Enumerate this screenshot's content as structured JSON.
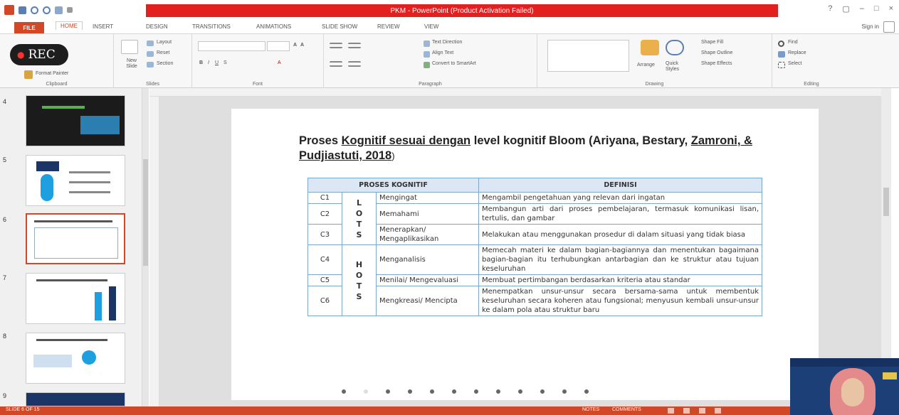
{
  "window": {
    "title": "PKM - PowerPoint (Product Activation Failed)",
    "controls": [
      "?",
      "▢",
      "–",
      "□",
      "×"
    ],
    "sign_in": "Sign in"
  },
  "tabs": [
    "FILE",
    "HOME",
    "INSERT",
    "DESIGN",
    "TRANSITIONS",
    "ANIMATIONS",
    "SLIDE SHOW",
    "REVIEW",
    "VIEW"
  ],
  "ribbon": {
    "clipboard": {
      "format_painter": "Format Painter",
      "label": "Clipboard"
    },
    "slides": {
      "new_slide": "New Slide",
      "layout": "Layout",
      "reset": "Reset",
      "section": "Section",
      "label": "Slides"
    },
    "font": {
      "label": "Font"
    },
    "paragraph": {
      "text_direction": "Text Direction",
      "align_text": "Align Text",
      "convert_smartart": "Convert to SmartArt",
      "label": "Paragraph"
    },
    "drawing": {
      "arrange": "Arrange",
      "quick_styles": "Quick Styles",
      "shape_fill": "Shape Fill",
      "shape_outline": "Shape Outline",
      "shape_effects": "Shape Effects",
      "label": "Drawing"
    },
    "editing": {
      "find": "Find",
      "replace": "Replace",
      "select": "Select",
      "label": "Editing"
    }
  },
  "recording": {
    "label": "REC"
  },
  "slides_panel": {
    "numbers": [
      "4",
      "5",
      "6",
      "7",
      "8",
      "9"
    ],
    "active": "6"
  },
  "slide": {
    "title_part1": "Proses ",
    "title_u1": "Kognitif sesuai dengan",
    "title_part2": " level kognitif Bloom  (Ariyana, Bestary, ",
    "title_u2": "Zamroni, & Pudjiastuti, 2018",
    "title_end": ")",
    "table": {
      "headers": [
        "PROSES KOGNITIF",
        "DEFINISI"
      ],
      "lots_label": "L\nO\nT\nS",
      "hots_label": "H\nO\nT\nS",
      "rows": [
        {
          "code": "C1",
          "process": "Mengingat",
          "definition": "Mengambil pengetahuan yang relevan dari ingatan"
        },
        {
          "code": "C2",
          "process": "Memahami",
          "definition": "Membangun arti dari proses pembelajaran, termasuk komunikasi lisan, tertulis, dan gambar"
        },
        {
          "code": "C3",
          "process": "Menerapkan/ Mengaplikasikan",
          "definition": "Melakukan atau menggunakan prosedur di dalam situasi yang tidak biasa"
        },
        {
          "code": "C4",
          "process": "Menganalisis",
          "definition": "Memecah materi ke dalam bagian-bagiannya dan menentukan bagaimana bagian-bagian itu terhubungkan antarbagian dan ke struktur atau tujuan keseluruhan"
        },
        {
          "code": "C5",
          "process": "Menilai/ Mengevaluasi",
          "definition": "Membuat pertimbangan berdasarkan kriteria atau standar"
        },
        {
          "code": "C6",
          "process": "Mengkreasi/ Mencipta",
          "definition": "Menempatkan unsur-unsur secara bersama-sama untuk membentuk keseluruhan secara koheren atau fungsional; menyusun kembali unsur-unsur ke dalam pola atau struktur baru"
        }
      ]
    }
  },
  "statusbar": {
    "slide_count": "SLIDE 6 OF 15",
    "notes": "NOTES",
    "comments": "COMMENTS"
  },
  "colors": {
    "accent": "#d24726",
    "title_bar_alert": "#e31f1f",
    "table_border": "#7ea6c8",
    "table_header": "#dbe7f4"
  }
}
